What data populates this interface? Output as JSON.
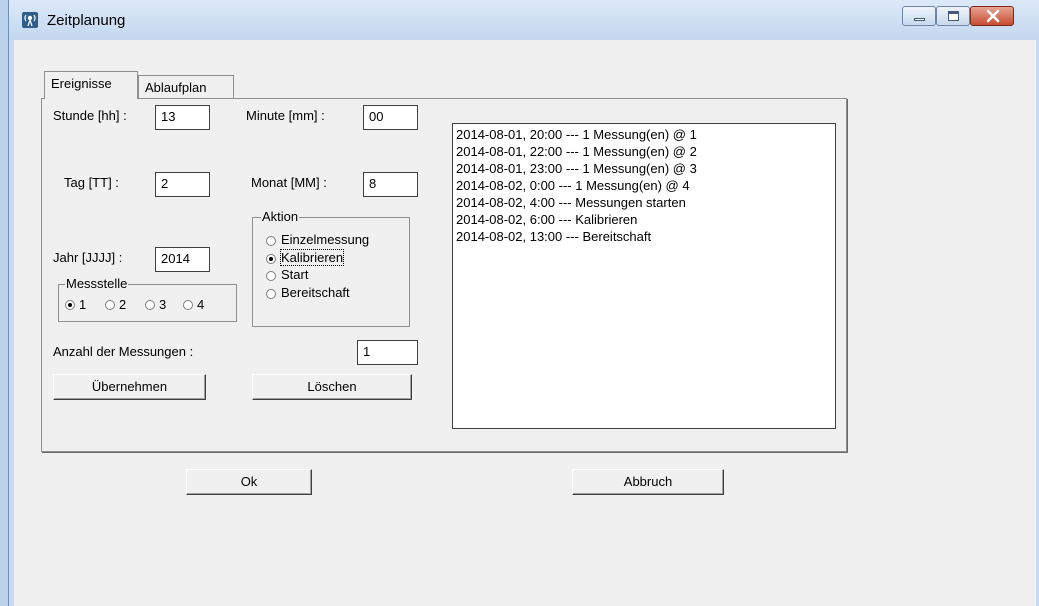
{
  "window": {
    "title": "Zeitplanung"
  },
  "tabs": [
    {
      "label": "Ereignisse"
    },
    {
      "label": "Ablaufplan"
    }
  ],
  "form": {
    "hour_label": "Stunde [hh] :",
    "hour_value": "13",
    "minute_label": "Minute [mm] :",
    "minute_value": "00",
    "day_label": "Tag [TT] :",
    "day_value": "2",
    "month_label": "Monat [MM] :",
    "month_value": "8",
    "year_label": "Jahr [JJJJ] :",
    "year_value": "2014",
    "count_label": "Anzahl der Messungen :",
    "count_value": "1"
  },
  "messstelle": {
    "legend": "Messstelle",
    "options": [
      {
        "label": "1",
        "checked": true
      },
      {
        "label": "2",
        "checked": false
      },
      {
        "label": "3",
        "checked": false
      },
      {
        "label": "4",
        "checked": false
      }
    ]
  },
  "aktion": {
    "legend": "Aktion",
    "options": [
      {
        "label": "Einzelmessung",
        "checked": false
      },
      {
        "label": "Kalibrieren",
        "checked": true
      },
      {
        "label": "Start",
        "checked": false
      },
      {
        "label": "Bereitschaft",
        "checked": false
      }
    ]
  },
  "buttons": {
    "apply": "Übernehmen",
    "delete": "Löschen",
    "ok": "Ok",
    "cancel": "Abbruch"
  },
  "events": [
    "2014-08-01, 20:00  ---  1 Messung(en) @ 1",
    "2014-08-01, 22:00  ---  1 Messung(en) @ 2",
    "2014-08-01, 23:00  ---  1 Messung(en) @ 3",
    "2014-08-02,  0:00  ---  1 Messung(en) @ 4",
    "2014-08-02,  4:00  ---  Messungen starten",
    "2014-08-02,  6:00  ---  Kalibrieren",
    "2014-08-02, 13:00  ---  Bereitschaft"
  ],
  "icons": {
    "app": "antenna-icon",
    "minimize": "minimize-icon",
    "maximize": "maximize-icon",
    "close": "close-icon"
  },
  "colors": {
    "titlebar": "#c8daf0",
    "close_button": "#c74a30",
    "dialog_bg": "#f0f0f0"
  }
}
